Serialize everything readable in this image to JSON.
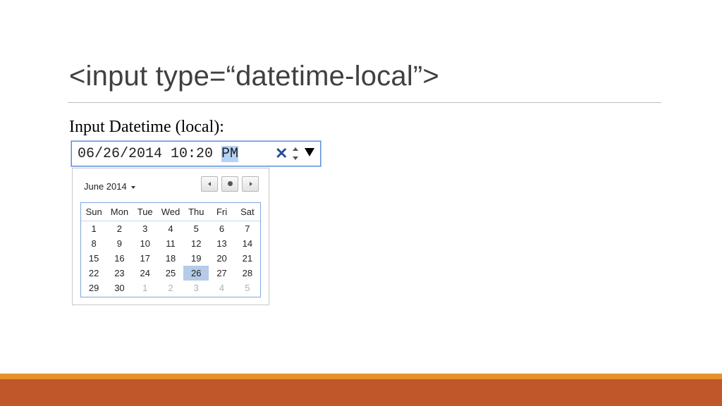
{
  "slide": {
    "title": "<input type=“datetime-local”>"
  },
  "form": {
    "label": "Input Datetime (local):",
    "input": {
      "value_prefix": "06/26/2014 10:20 ",
      "value_selected": "PM",
      "clear_glyph": "✕"
    }
  },
  "picker": {
    "month_label": "June 2014",
    "weekdays": [
      "Sun",
      "Mon",
      "Tue",
      "Wed",
      "Thu",
      "Fri",
      "Sat"
    ],
    "weeks": [
      [
        "1",
        "2",
        "3",
        "4",
        "5",
        "6",
        "7"
      ],
      [
        "8",
        "9",
        "10",
        "11",
        "12",
        "13",
        "14"
      ],
      [
        "15",
        "16",
        "17",
        "18",
        "19",
        "20",
        "21"
      ],
      [
        "22",
        "23",
        "24",
        "25",
        "26",
        "27",
        "28"
      ],
      [
        "29",
        "30",
        "1",
        "2",
        "3",
        "4",
        "5"
      ]
    ],
    "selected_day": "26",
    "next_month_days_in_last_week": 5
  },
  "colors": {
    "accent_bar_top": "#e8902a",
    "accent_bar_bottom": "#bf572a",
    "selection": "#b5cbe8",
    "input_border": "#5b8fd6"
  },
  "icons": {
    "clear": "close-icon",
    "spinner": "spinner-arrows-icon",
    "dropdown": "chevron-down-icon",
    "prev": "chevron-left-icon",
    "today": "dot-icon",
    "next": "chevron-right-icon"
  }
}
